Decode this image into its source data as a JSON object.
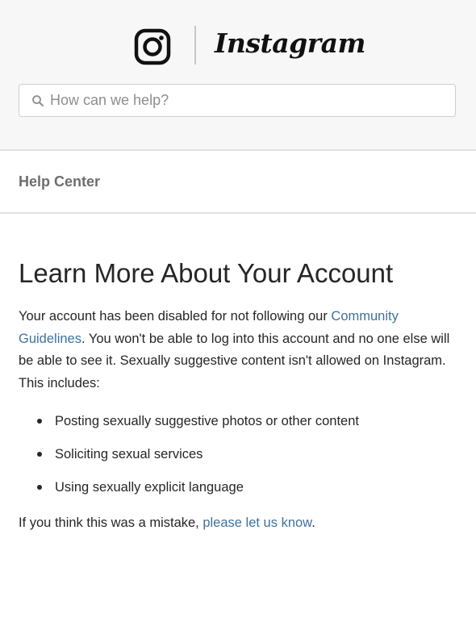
{
  "header": {
    "brand": "Instagram",
    "search": {
      "placeholder": "How can we help?",
      "value": ""
    }
  },
  "breadcrumb": {
    "label": "Help Center"
  },
  "article": {
    "title": "Learn More About Your Account",
    "intro_before_link": "Your account has been disabled for not following our ",
    "intro_link": "Community Guidelines",
    "intro_after_link": ". You won't be able to log into this account and no one else will be able to see it. Sexually suggestive content isn't allowed on Instagram. This includes:",
    "rules": [
      "Posting sexually suggestive photos or other content",
      "Soliciting sexual services",
      "Using sexually explicit language"
    ],
    "closing_before_link": "If you think this was a mistake, ",
    "closing_link": "please let us know",
    "closing_after_link": "."
  },
  "colors": {
    "link": "#3f729b",
    "header_bg": "#f7f7f7",
    "text": "#262626"
  },
  "icons": [
    "instagram-glyph-icon",
    "search-icon"
  ]
}
